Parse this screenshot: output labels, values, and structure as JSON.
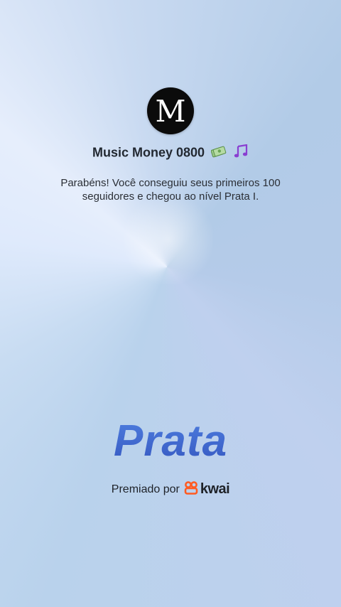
{
  "profile": {
    "avatar_letter": "M",
    "name": "Music Money 0800"
  },
  "message": "Parabéns! Você conseguiu seus primeiros 100 seguidores e chegou ao nível Prata I.",
  "level": {
    "title": "Prata",
    "color": "#3f64c8"
  },
  "award": {
    "label": "Premiado por",
    "brand": "kwai",
    "brand_color": "#ff5b22"
  },
  "icons": {
    "money": "money-bills-emoji-icon",
    "notes": "musical-notes-emoji-icon",
    "brand": "kwai-logo-icon"
  }
}
